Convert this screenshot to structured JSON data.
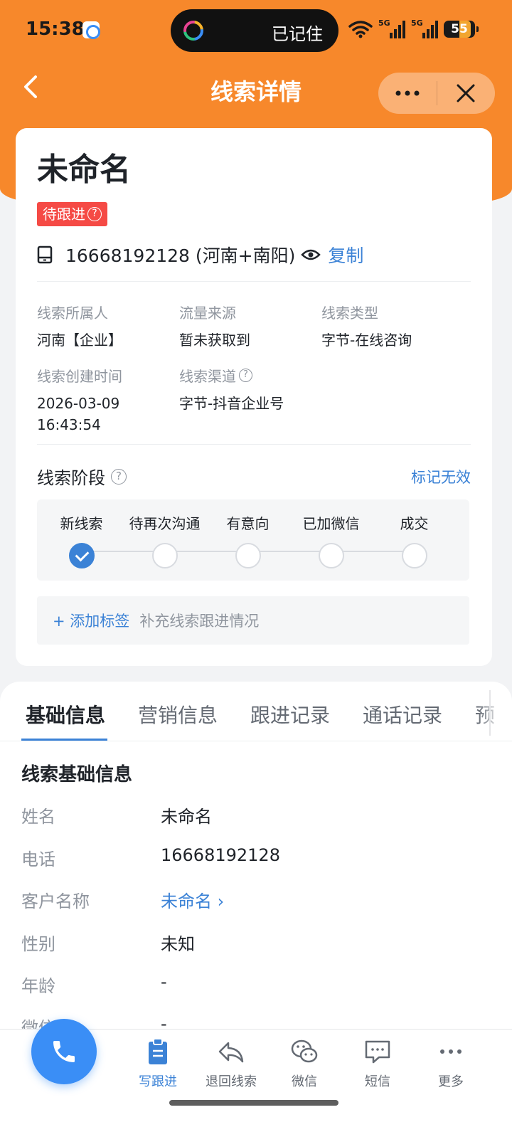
{
  "status_bar": {
    "time": "15:38",
    "island_text": "已记住",
    "signal_1_label": "5G",
    "signal_2_label": "5G",
    "battery": "55"
  },
  "header": {
    "title": "线索详情",
    "back_icon": "chevron-left-icon",
    "more_icon": "more-horizontal-icon",
    "close_icon": "close-icon"
  },
  "lead": {
    "name": "未命名",
    "status": "待跟进",
    "phone_display": "16668192128 (河南+南阳)",
    "copy_label": "复制",
    "info": [
      {
        "label": "线索所属人",
        "value": "河南【企业】"
      },
      {
        "label": "流量来源",
        "value": "暂未获取到"
      },
      {
        "label": "线索类型",
        "value": "字节-在线咨询"
      },
      {
        "label": "线索创建时间",
        "value": "2026-03-09 16:43:54"
      },
      {
        "label": "线索渠道",
        "value": "字节-抖音企业号"
      }
    ],
    "stage_title": "线索阶段",
    "mark_invalid": "标记无效",
    "stages": [
      {
        "label": "新线索",
        "done": true
      },
      {
        "label": "待再次沟通",
        "done": false
      },
      {
        "label": "有意向",
        "done": false
      },
      {
        "label": "已加微信",
        "done": false
      },
      {
        "label": "成交",
        "done": false
      }
    ],
    "add_tag": "+ 添加标签",
    "tag_hint": "补充线索跟进情况"
  },
  "tabs": [
    "基础信息",
    "营销信息",
    "跟进记录",
    "通话记录",
    "预"
  ],
  "basic_info": {
    "title": "线索基础信息",
    "fields": [
      {
        "label": "姓名",
        "value": "未命名"
      },
      {
        "label": "电话",
        "value": "16668192128"
      },
      {
        "label": "客户名称",
        "value": "未命名 ›"
      },
      {
        "label": "性别",
        "value": "未知"
      },
      {
        "label": "年龄",
        "value": "-"
      },
      {
        "label": "微信",
        "value": "-"
      }
    ]
  },
  "actions": [
    {
      "label": "写跟进",
      "icon": "clipboard-icon"
    },
    {
      "label": "退回线索",
      "icon": "reply-icon"
    },
    {
      "label": "微信",
      "icon": "wechat-icon"
    },
    {
      "label": "短信",
      "icon": "message-icon"
    },
    {
      "label": "更多",
      "icon": "more-icon"
    }
  ],
  "colors": {
    "brand_orange": "#f7882b",
    "accent_blue": "#3b82d6",
    "status_red": "#f54a45"
  }
}
